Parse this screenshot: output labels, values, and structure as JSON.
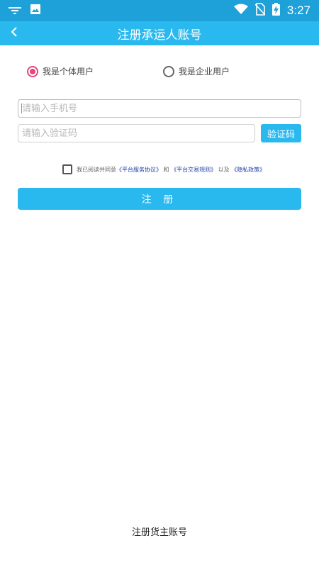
{
  "status_bar": {
    "time": "3:27",
    "left_icons": [
      "notification-icon",
      "image-icon"
    ],
    "right_icons": [
      "wifi-icon",
      "no-sim-icon",
      "battery-charging-icon"
    ]
  },
  "header": {
    "title": "注册承运人账号",
    "back_icon": "chevron-left-icon"
  },
  "user_type": {
    "options": [
      {
        "label": "我是个体用户",
        "selected": true
      },
      {
        "label": "我是企业用户",
        "selected": false
      }
    ]
  },
  "form": {
    "phone_placeholder": "请输入手机号",
    "code_placeholder": "请输入验证码",
    "code_button_label": "验证码"
  },
  "agreement": {
    "checked": false,
    "prefix": "我已阅读并同意",
    "link1": "《平台服务协议》",
    "and": "和",
    "link2": "《平台交易规则》",
    "and2": "以及",
    "link3": "《隐私政策》"
  },
  "register_label": "注 册",
  "switch_account_label": "注册货主账号",
  "colors": {
    "status_bar": "#1ea0d8",
    "primary": "#29b9ef",
    "radio_active": "#e8457a",
    "link": "#1f3fa8"
  }
}
